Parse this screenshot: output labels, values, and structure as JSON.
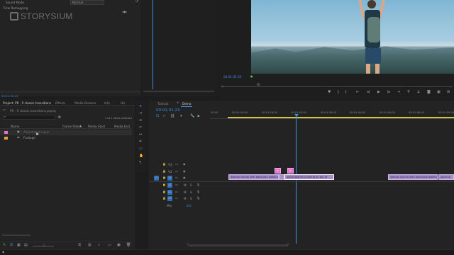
{
  "effect_controls": {
    "sound_mode_label": "Sound Mode",
    "sound_mode_value": "Normal",
    "time_remapping_label": "Time Remapping",
    "timecode": "00:01:31:23"
  },
  "watermark": "STORYSIUM",
  "program": {
    "timecode": "00:01:31:23",
    "zoom": "Fit"
  },
  "project": {
    "tabs": [
      "Project: PR - 5 classic transitions",
      "Effects",
      "Media Browser",
      "Info",
      "His"
    ],
    "path": "PR - 5 classic transitions.prproj",
    "selection_count": "1 of 1 items selected",
    "columns": [
      "Name",
      "Frame Rate",
      "Media Start",
      "Media End"
    ],
    "items": [
      {
        "name": "Adjustment Layer",
        "color": "#e36fcf"
      },
      {
        "name": "Footage",
        "color": "#e9a13a"
      }
    ]
  },
  "timeline": {
    "tabs": [
      "Tutorial",
      "Demo"
    ],
    "active_tab": "Demo",
    "timecode": "00:01:31:23",
    "ruler": [
      "00:00",
      "00:01:24:00",
      "00:01:28:00",
      "00:01:32:00",
      "00:01:36:00",
      "00:01:40:00",
      "00:01:44:00",
      "00:01:48:00",
      "00:01:52:00"
    ],
    "video_tracks": [
      "V3",
      "V2",
      "V1"
    ],
    "audio_tracks": [
      "A1",
      "A2",
      "A3"
    ],
    "mix_label": "Mix",
    "mix_value": "0.0",
    "clips_v1": [
      "woman tourist with backpack walking",
      "joyful woman jumping on top of",
      "woman tourist with backpack walking",
      "joyful w"
    ],
    "clip_v2_marker": "fx"
  },
  "colors": {
    "accent": "#3f8ee8",
    "clip_video": "#a78dc9",
    "clip_adjust": "#e36fcf",
    "playhead": "#3f8ee8"
  }
}
